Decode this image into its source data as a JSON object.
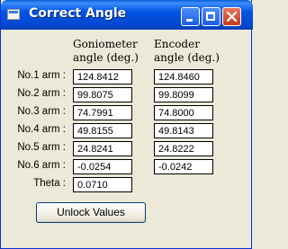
{
  "window": {
    "title": "Correct Angle",
    "buttons": {
      "minimize": "minimize",
      "maximize": "maximize",
      "close": "close"
    }
  },
  "headers": {
    "goniometer": [
      "Goniometer",
      "angle (deg.)"
    ],
    "encoder": [
      "Encoder",
      "angle (deg.)"
    ]
  },
  "rows": [
    {
      "label": "No.1 arm :",
      "goniometer": "124.8412",
      "encoder": "124.8460"
    },
    {
      "label": "No.2 arm :",
      "goniometer": "99.8075",
      "encoder": "99.8099"
    },
    {
      "label": "No.3 arm :",
      "goniometer": "74.7991",
      "encoder": "74.8000"
    },
    {
      "label": "No.4 arm :",
      "goniometer": "49.8155",
      "encoder": "49.8143"
    },
    {
      "label": "No.5 arm :",
      "goniometer": "24.8241",
      "encoder": "24.8222"
    },
    {
      "label": "No.6 arm :",
      "goniometer": "-0.0254",
      "encoder": "-0.0242"
    }
  ],
  "theta": {
    "label": "Theta :",
    "value": "0.0710"
  },
  "unlock_button": "Unlock Values",
  "icons": [
    "app-icon",
    "minimize-icon",
    "maximize-icon",
    "close-icon"
  ]
}
